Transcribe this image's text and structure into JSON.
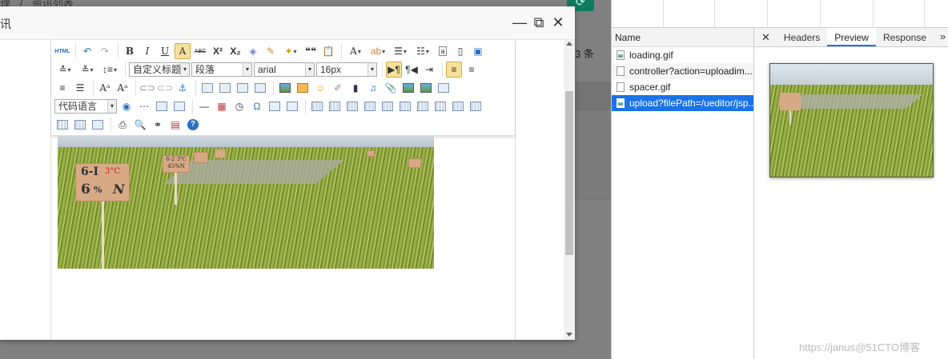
{
  "background": {
    "breadcrumb": [
      "理",
      "/",
      "资讯列表"
    ],
    "refresh_icon": "refresh-icon",
    "count_suffix": "3 条",
    "table_rows": [
      "",
      "",
      "",
      ""
    ]
  },
  "modal": {
    "title": "讯",
    "minimize_glyph": "—",
    "maximize_glyph": "⧉",
    "close_glyph": "✕"
  },
  "toolbar": {
    "html_label": "HTML",
    "bold": "B",
    "italic": "I",
    "underline": "U",
    "fontborder": "A",
    "strike": "ABC",
    "superscript": "X²",
    "subscript": "X₂",
    "blockquote": "❝❝",
    "forecolor": "A",
    "custom_style": "自定义标题",
    "paragraph": "段落",
    "font_family": "arial",
    "font_size": "16px",
    "code_language": "代码语言",
    "special_char": "Ω",
    "help": "?"
  },
  "content": {
    "sign_main": [
      "6-I",
      "3°C",
      "6",
      "%",
      "N"
    ],
    "sign_small": [
      "6-2 3℃",
      "45%N",
      "",
      "",
      "",
      ""
    ]
  },
  "devtools": {
    "name_header": "Name",
    "requests": [
      {
        "name": "loading.gif",
        "icon": "image-file-icon",
        "selected": false
      },
      {
        "name": "controller?action=uploadim...",
        "icon": "file-icon",
        "selected": false
      },
      {
        "name": "spacer.gif",
        "icon": "file-icon",
        "selected": false
      },
      {
        "name": "upload?filePath=/ueditor/jsp...",
        "icon": "image-file-icon",
        "selected": true
      }
    ],
    "tabs": [
      "Headers",
      "Preview",
      "Response"
    ],
    "active_tab": "Preview",
    "close_glyph": "✕",
    "more_glyph": "»"
  },
  "watermark": "https://janus@51CTO博客",
  "colors": {
    "accent_blue": "#1a73e8",
    "green_button": "#0e7a5e",
    "active_tool": "#f7e19a"
  }
}
